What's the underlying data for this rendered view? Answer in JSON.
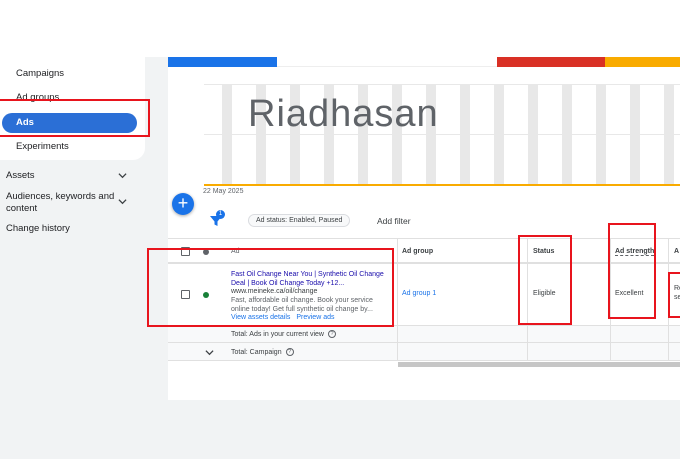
{
  "sidebar": {
    "items": [
      {
        "label": "Campaigns"
      },
      {
        "label": "Ad groups"
      },
      {
        "label": "Ads",
        "active": true
      },
      {
        "label": "Experiments"
      }
    ],
    "sections": [
      {
        "label": "Assets",
        "expandable": true
      },
      {
        "label": "Audiences, keywords and content",
        "expandable": true
      },
      {
        "label": "Change history",
        "expandable": false
      }
    ]
  },
  "chart": {
    "watermark": "Riadhasan",
    "date_label": "22 May 2025",
    "bar_colors": [
      "#1a73e8",
      "#ffffff",
      "#ffffff",
      "#d93025",
      "#f9ab00"
    ]
  },
  "toolbar": {
    "add_button": "+",
    "filter_badge": "1",
    "filter_chip": "Ad status: Enabled, Paused",
    "add_filter": "Add filter"
  },
  "table": {
    "headers": {
      "ad": "Ad",
      "ad_group": "Ad group",
      "status": "Status",
      "ad_strength": "Ad strength",
      "next": "A"
    },
    "row": {
      "title": "Fast Oil Change Near You | Synthetic Oil Change Deal | Book Oil Change Today  +12...",
      "url": "www.meineke.ca/oil/change",
      "description": "Fast, affordable oil change. Book your service online today! Get full synthetic oil change by...",
      "view_assets": "View assets details",
      "preview": "Preview ads",
      "ad_group": "Ad group 1",
      "status": "Eligible",
      "ad_strength": "Excellent",
      "next_partial": "Re se"
    },
    "totals": {
      "ads": "Total: Ads in your current view",
      "campaign": "Total: Campaign"
    }
  },
  "colors": {
    "highlight": "#e8141d",
    "accent": "#1a73e8",
    "active_nav": "#2b6fd6",
    "status_green": "#188038"
  }
}
